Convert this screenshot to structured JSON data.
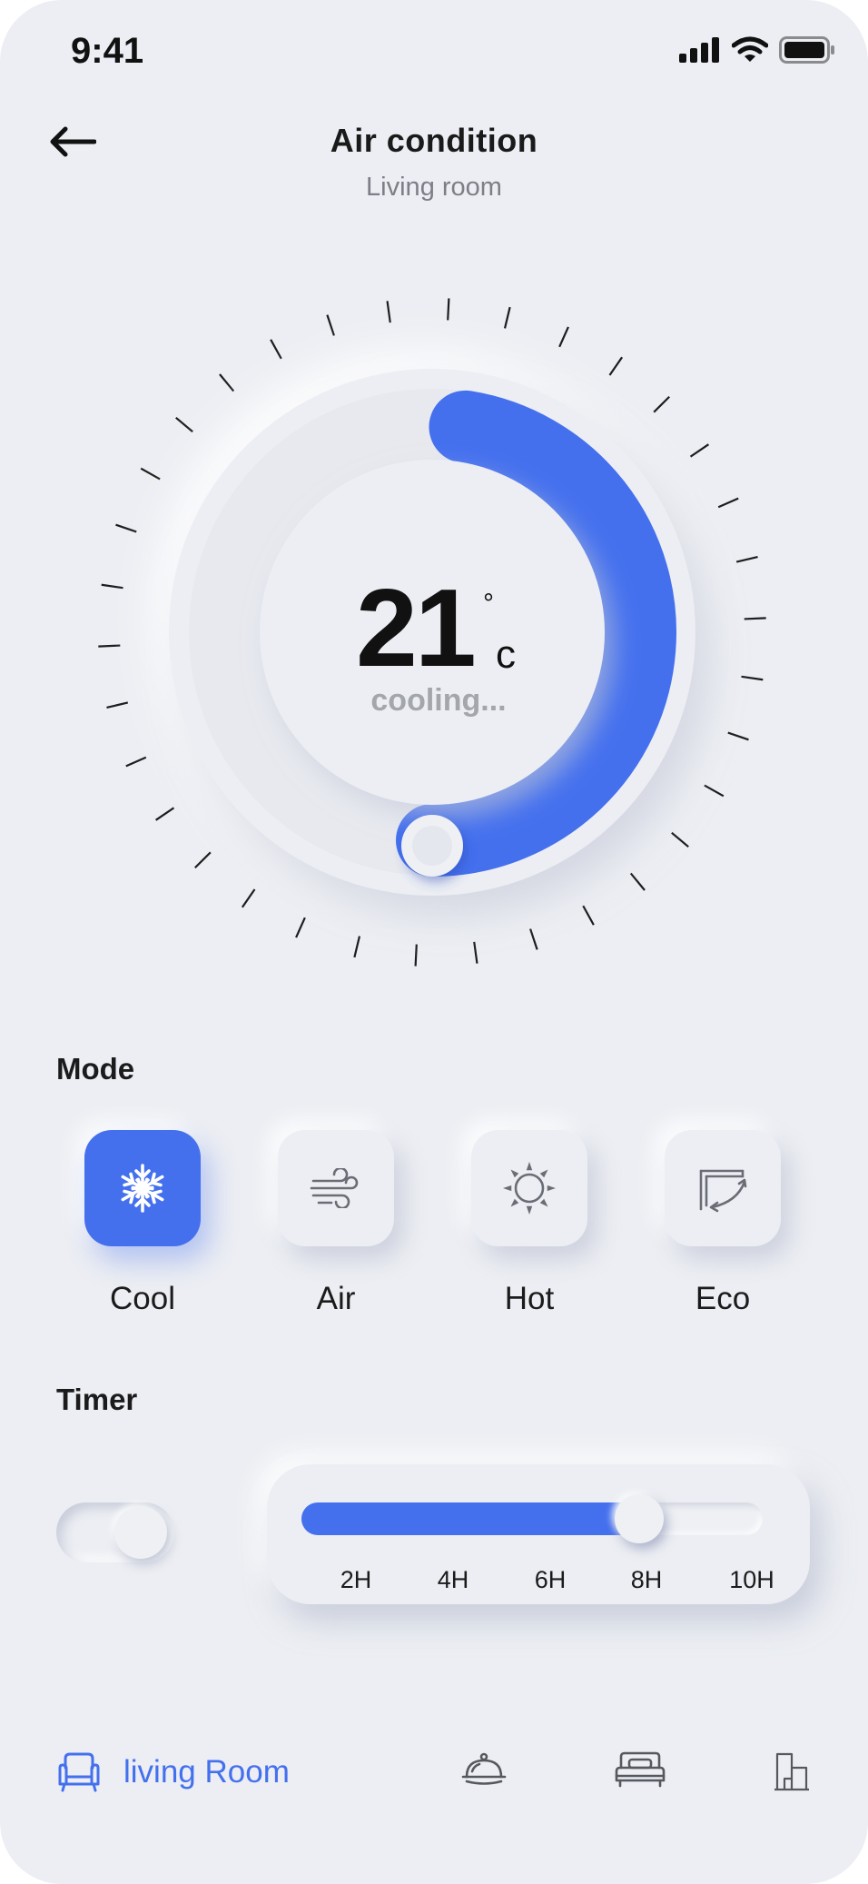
{
  "status_bar": {
    "time": "9:41"
  },
  "header": {
    "title": "Air condition",
    "subtitle": "Living room"
  },
  "thermostat": {
    "temperature": "21",
    "degree_symbol": "°",
    "unit": "c",
    "status": "cooling...",
    "arc_fraction": 0.5,
    "accent": "#4470ee"
  },
  "mode": {
    "label": "Mode",
    "items": [
      {
        "label": "Cool",
        "icon": "snowflake-icon",
        "active": true
      },
      {
        "label": "Air",
        "icon": "wind-icon",
        "active": false
      },
      {
        "label": "Hot",
        "icon": "sun-icon",
        "active": false
      },
      {
        "label": "Eco",
        "icon": "eco-icon",
        "active": false
      }
    ]
  },
  "timer": {
    "label": "Timer",
    "enabled": true,
    "ticks": [
      "2H",
      "4H",
      "6H",
      "8H",
      "10H"
    ],
    "selected": "8H",
    "fill_fraction": 0.75
  },
  "bottom_nav": {
    "items": [
      {
        "label": "living Room",
        "icon": "armchair-icon",
        "active": true
      },
      {
        "label": "",
        "icon": "cloche-icon",
        "active": false
      },
      {
        "label": "",
        "icon": "bed-icon",
        "active": false
      },
      {
        "label": "",
        "icon": "building-icon",
        "active": false
      }
    ]
  }
}
